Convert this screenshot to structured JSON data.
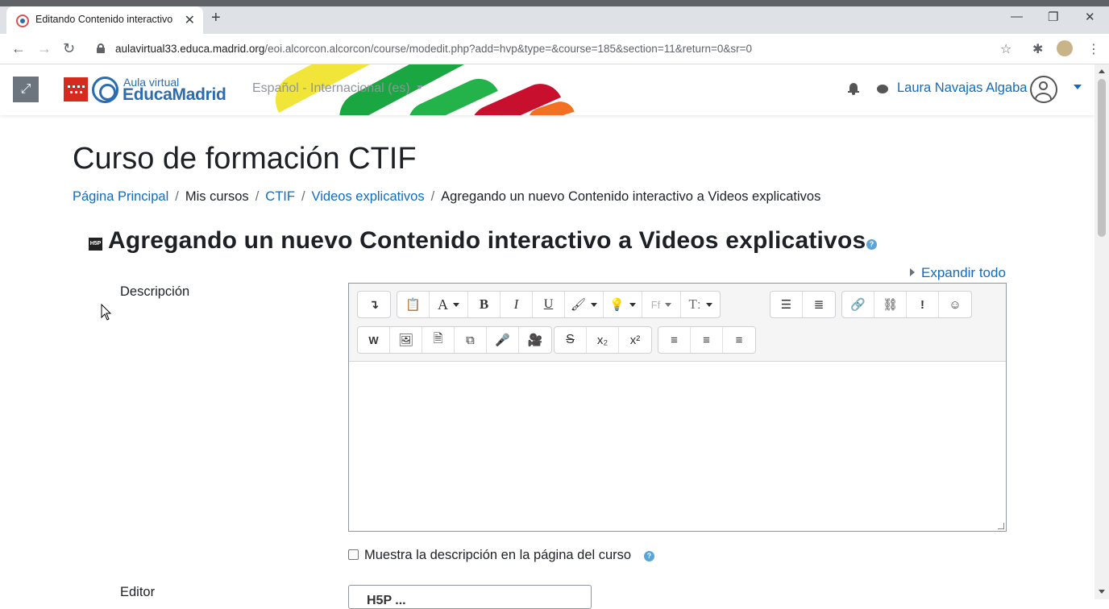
{
  "browser": {
    "tab_title": "Editando Contenido interactivo",
    "url_host": "aulavirtual33.educa.madrid.org",
    "url_path": "/eoi.alcorcon.alcorcon/course/modedit.php?add=hvp&type=&course=185&section=11&return=0&sr=0"
  },
  "navbar": {
    "logo_line1": "Aula virtual",
    "logo_line2": "EducaMadrid",
    "language": "Español - Internacional (es)",
    "user_name": "Laura Navajas Algaba"
  },
  "page": {
    "course_title": "Curso de formación CTIF",
    "breadcrumb": [
      {
        "label": "Página Principal"
      },
      {
        "label": "Mis cursos"
      },
      {
        "label": "CTIF"
      },
      {
        "label": "Videos explicativos"
      },
      {
        "label": "Agregando un nuevo Contenido interactivo a Videos explicativos"
      }
    ],
    "heading": "Agregando un nuevo Contenido interactivo a Videos explicativos",
    "h5p_badge": "H5P",
    "expand_all": "Expandir todo",
    "description_label": "Descripción",
    "show_description_label": "Muestra la descripción en la página del curso",
    "editor_label": "Editor",
    "editor_select_value": "H5P ..."
  },
  "toolbar_icons": [
    "collapse-icon",
    "paste-icon",
    "font-color-icon",
    "bold-icon",
    "italic-icon",
    "underline-icon",
    "brush-icon",
    "idea-icon",
    "font-family-icon",
    "font-size-icon",
    "unordered-list-icon",
    "ordered-list-icon",
    "link-icon",
    "unlink-icon",
    "exclamation-icon",
    "emoji-icon",
    "word-import-icon",
    "image-icon",
    "media-icon",
    "manage-files-icon",
    "record-audio-icon",
    "record-video-icon",
    "strikethrough-icon",
    "subscript-icon",
    "superscript-icon",
    "align-left-icon",
    "align-center-icon",
    "align-right-icon"
  ],
  "colors": {
    "link": "#0f6cbf",
    "brand_red": "#d52b1e",
    "brand_blue": "#2b6cb0"
  }
}
